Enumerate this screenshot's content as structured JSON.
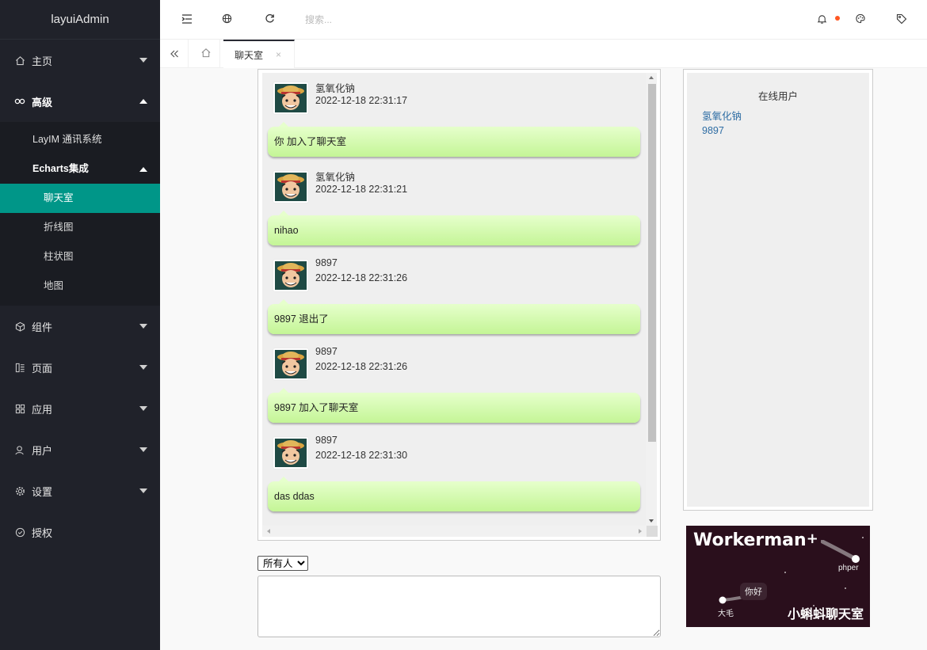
{
  "app": {
    "title": "layuiAdmin"
  },
  "sidebar": {
    "items": [
      {
        "label": "主页",
        "icon": "home-icon"
      },
      {
        "label": "高级",
        "icon": "senior-icon"
      },
      {
        "label": "组件",
        "icon": "component-icon"
      },
      {
        "label": "页面",
        "icon": "template-icon"
      },
      {
        "label": "应用",
        "icon": "app-icon"
      },
      {
        "label": "用户",
        "icon": "user-icon"
      },
      {
        "label": "设置",
        "icon": "set-icon"
      },
      {
        "label": "授权",
        "icon": "auz-icon"
      }
    ],
    "advanced_sub": [
      {
        "label": "LayIM 通讯系统"
      },
      {
        "label": "Echarts集成"
      }
    ],
    "echarts_sub": [
      {
        "label": "聊天室"
      },
      {
        "label": "折线图"
      },
      {
        "label": "柱状图"
      },
      {
        "label": "地图"
      }
    ]
  },
  "header": {
    "search_placeholder": "搜索...",
    "accent_dot_color": "#ff5722"
  },
  "tabs": {
    "items": [
      {
        "label": "聊天室",
        "close": "×"
      }
    ]
  },
  "chat": {
    "messages": [
      {
        "user": "氢氧化钠",
        "time": "2022-12-18 22:31:17",
        "text": "你 加入了聊天室"
      },
      {
        "user": "氢氧化钠",
        "time": "2022-12-18 22:31:21",
        "text": "nihao"
      },
      {
        "user": "9897",
        "time": "2022-12-18 22:31:26",
        "text": "9897 退出了"
      },
      {
        "user": "9897",
        "time": "2022-12-18 22:31:26",
        "text": "9897 加入了聊天室"
      },
      {
        "user": "9897",
        "time": "2022-12-18 22:31:30",
        "text": "das ddas"
      }
    ]
  },
  "online": {
    "title": "在线用户",
    "users": [
      "氢氧化钠",
      "9897"
    ]
  },
  "banner": {
    "brand": "Workerman",
    "plus": "+",
    "tag_phper": "phper",
    "tag_damao": "大毛",
    "hello": "你好",
    "cn_title": "小蝌蚪聊天室"
  },
  "composer": {
    "target_options": [
      "所有人"
    ],
    "selected": "所有人"
  },
  "colors": {
    "accent": "#009688",
    "sidebar_bg": "#20222a",
    "bubble_top": "#e6ffcc",
    "bubble_bottom": "#c4f596"
  }
}
